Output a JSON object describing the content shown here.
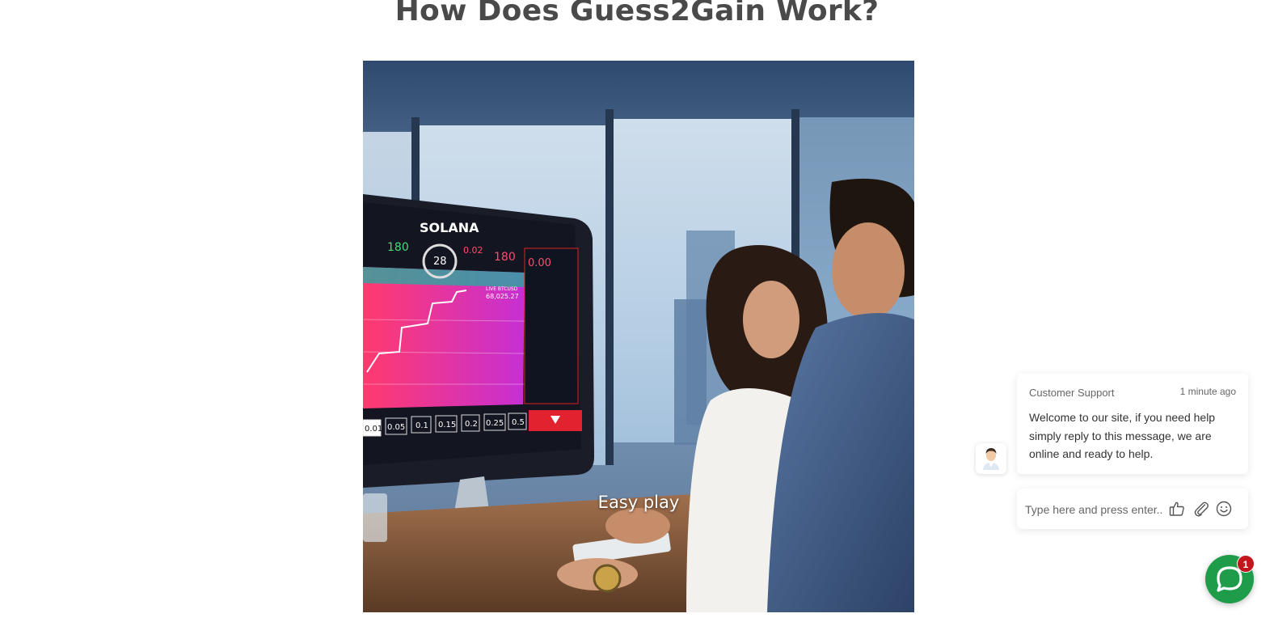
{
  "page": {
    "title": "How Does Guess2Gain Work?"
  },
  "video": {
    "caption": "Easy play",
    "screen": {
      "brand": "SOLANA",
      "timer": "28",
      "payout_left": "180",
      "payout_right": "180",
      "volume": "0.02",
      "live_label": "LIVE BTCUSD",
      "live_price": "68,025.27",
      "balance": "0.00",
      "bet_options": [
        "0.01",
        "0.05",
        "0.1",
        "0.15",
        "0.2",
        "0.25",
        "0.5"
      ]
    }
  },
  "chat": {
    "sender": "Customer Support",
    "time": "1 minute ago",
    "message": "Welcome to our site, if you need help simply reply to this message, we are online and ready to help.",
    "input_placeholder": "Type here and press enter..",
    "unread_count": "1",
    "icons": [
      "thumbs-up-icon",
      "paperclip-icon",
      "smiley-icon",
      "chat-bubble-icon"
    ],
    "accent_color": "#1e9c4a",
    "badge_color": "#c3161c"
  }
}
